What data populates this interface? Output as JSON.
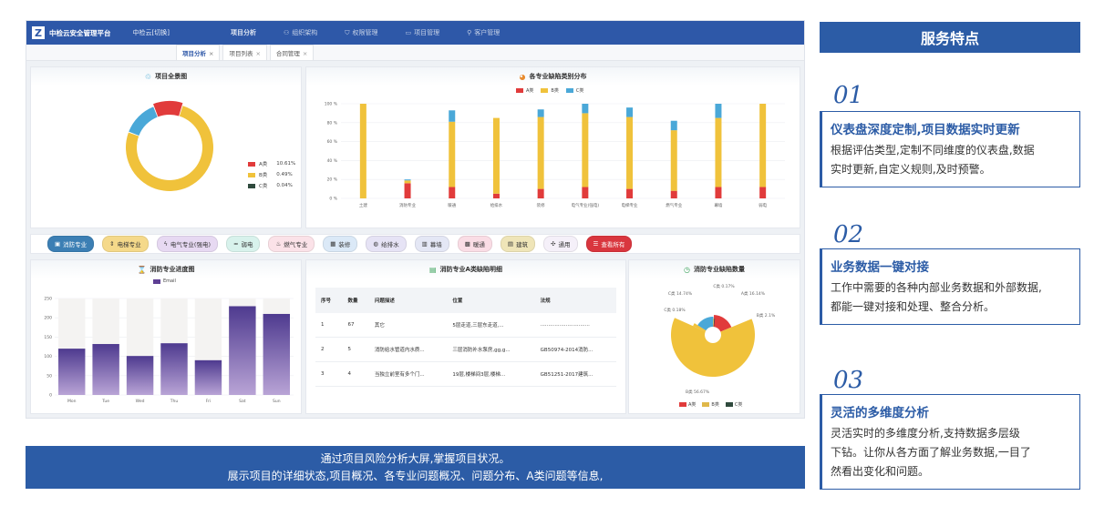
{
  "app": {
    "title": "中检云安全管理平台",
    "tenant": "中检云[切换]",
    "nav": [
      {
        "label": "项目分析",
        "icon": "chart-icon"
      },
      {
        "label": "组织架构",
        "icon": "org-icon"
      },
      {
        "label": "权限管理",
        "icon": "shield-icon"
      },
      {
        "label": "项目管理",
        "icon": "folder-icon"
      },
      {
        "label": "客户管理",
        "icon": "user-icon"
      }
    ],
    "tabs": [
      {
        "label": "项目分析",
        "close": "×"
      },
      {
        "label": "项目列表",
        "close": "×"
      },
      {
        "label": "合同管理",
        "close": "×"
      }
    ]
  },
  "overview": {
    "title": "项目全景图",
    "legend": [
      {
        "label": "A类",
        "value": "10.61%",
        "color": "#e13b3b"
      },
      {
        "label": "B类",
        "value": "0.49%",
        "color": "#f0c23b"
      },
      {
        "label": "C类",
        "value": "0.04%",
        "color": "#2f4a3d"
      }
    ]
  },
  "categories": [
    {
      "label": "消防专业",
      "icon": "fire-extinguisher-icon",
      "bg": "#3c7fb4",
      "color": "#ffffff"
    },
    {
      "label": "电梯专业",
      "icon": "elevator-icon",
      "bg": "#f5d98a",
      "color": "#333333"
    },
    {
      "label": "电气专业(强电)",
      "icon": "lightning-icon",
      "bg": "#e7d9f2",
      "color": "#333333"
    },
    {
      "label": "弱电",
      "icon": "wifi-icon",
      "bg": "#d8f2ec",
      "color": "#333333"
    },
    {
      "label": "燃气专业",
      "icon": "flame-icon",
      "bg": "#fbe2e8",
      "color": "#333333"
    },
    {
      "label": "装修",
      "icon": "paint-roller-icon",
      "bg": "#dbe9f7",
      "color": "#333333"
    },
    {
      "label": "给排水",
      "icon": "pipe-icon",
      "bg": "#e6e3f5",
      "color": "#333333"
    },
    {
      "label": "幕墙",
      "icon": "curtain-wall-icon",
      "bg": "#e4e7f5",
      "color": "#333333"
    },
    {
      "label": "暖通",
      "icon": "hvac-icon",
      "bg": "#fadde5",
      "color": "#333333"
    },
    {
      "label": "建筑",
      "icon": "building-icon",
      "bg": "#efe5b8",
      "color": "#333333"
    },
    {
      "label": "通用",
      "icon": "general-icon",
      "bg": "#f5f0f9",
      "color": "#333333"
    },
    {
      "label": "查看所有",
      "icon": "list-icon",
      "bg": "#d9363e",
      "color": "#ffffff"
    }
  ],
  "progress": {
    "title": "消防专业进度图"
  },
  "detail": {
    "title": "消防专业A类缺陷明细",
    "headers": [
      "序号",
      "数量",
      "问题描述",
      "位置",
      "法规"
    ],
    "rows": [
      [
        "1",
        "67",
        "其它",
        "5层走道,三层东走道,...",
        "..............................."
      ],
      [
        "2",
        "5",
        "消防给水管道内水质...",
        "三层消防补水泵房,gg,g...",
        "GB50974-2014消防..."
      ],
      [
        "3",
        "4",
        "当独立前室有多个门...",
        "19层,楼梯间3层,楼梯...",
        "GB51251-2017建筑..."
      ]
    ]
  },
  "defect_count": {
    "title": "消防专业缺陷数量",
    "labels": [
      {
        "text": "C类 14.74%",
        "color": "#4aa8d8"
      },
      {
        "text": "C类 0.17%",
        "color": "#f0c23b"
      },
      {
        "text": "A类 16.14%",
        "color": "#e13b3b"
      },
      {
        "text": "C类 0.18%",
        "color": "#444444"
      },
      {
        "text": "B类 2.1%",
        "color": "#f0c23b"
      },
      {
        "text": "B类 56.67%",
        "color": "#f0c23b"
      }
    ],
    "legend": [
      {
        "label": "A类",
        "color": "#e13b3b"
      },
      {
        "label": "B类",
        "color": "#e0b84a"
      },
      {
        "label": "C类",
        "color": "#2f4a3d"
      }
    ]
  },
  "banner": {
    "line1": "通过项目风险分析大屏,掌握项目状况。",
    "line2": "展示项目的详细状态,项目概况、各专业问题概况、问题分布、A类问题等信息,"
  },
  "features": {
    "title": "服务特点",
    "items": [
      {
        "num": "01",
        "heading": "仪表盘深度定制,项目数据实时更新",
        "lines": [
          "根据评估类型,定制不同维度的仪表盘,数据",
          "实时更新,自定义规则,及时预警。"
        ]
      },
      {
        "num": "02",
        "heading": "业务数据一键对接",
        "lines": [
          "工作中需要的各种内部业务数据和外部数据,",
          "都能一键对接和处理、整合分析。"
        ]
      },
      {
        "num": "03",
        "heading": "灵活的多维度分析",
        "lines": [
          "灵活实时的多维度分析,支持数据多层级",
          "下钻。让你从各方面了解业务数据,一目了",
          "然看出变化和问题。"
        ]
      }
    ]
  },
  "chart_data": [
    {
      "type": "pie",
      "title": "项目全景图",
      "slices": [
        {
          "name": "A类",
          "value": 10.61,
          "color": "#e13b3b"
        },
        {
          "name": "B类",
          "value": 76.0,
          "color": "#f0c23b"
        },
        {
          "name": "C类",
          "value": 13.39,
          "color": "#4aa8d8"
        }
      ]
    },
    {
      "type": "bar",
      "title": "各专业缺陷类别分布",
      "categories": [
        "土建",
        "消防专业",
        "暖通",
        "给排水",
        "装修",
        "电气专业(强电)",
        "电梯专业",
        "燃气专业",
        "幕墙",
        "弱电"
      ],
      "series": [
        {
          "name": "A类",
          "color": "#e13b3b",
          "values": [
            0,
            16,
            12,
            5,
            10,
            12,
            10,
            8,
            12,
            12
          ]
        },
        {
          "name": "B类",
          "color": "#f0c23b",
          "values": [
            100,
            3,
            69,
            80,
            76,
            78,
            76,
            64,
            73,
            88
          ]
        },
        {
          "name": "C类",
          "color": "#4aa8d8",
          "values": [
            0,
            1,
            12,
            0,
            8,
            10,
            10,
            10,
            15,
            0
          ]
        }
      ],
      "yticks": [
        "100 %",
        "80 %",
        "60 %",
        "40 %",
        "20 %",
        "0 %"
      ],
      "ylim": [
        0,
        100
      ]
    },
    {
      "type": "bar",
      "title": "消防专业进度图",
      "categories": [
        "Mon",
        "Tue",
        "Wed",
        "Thu",
        "Fri",
        "Sat",
        "Sun"
      ],
      "series": [
        {
          "name": "Email",
          "values": [
            120,
            132,
            101,
            134,
            90,
            230,
            210
          ]
        }
      ],
      "background_max": 250,
      "yticks": [
        "250",
        "200",
        "150",
        "100",
        "50",
        "0"
      ],
      "ylim": [
        0,
        250
      ]
    },
    {
      "type": "pie",
      "title": "消防专业缺陷数量",
      "slices": [
        {
          "name": "A类",
          "value": 16.14,
          "color": "#e13b3b"
        },
        {
          "name": "B类",
          "value": 56.67,
          "color": "#f0c23b"
        },
        {
          "name": "B类",
          "value": 2.1,
          "color": "#f0c23b"
        },
        {
          "name": "C类",
          "value": 14.74,
          "color": "#4aa8d8"
        },
        {
          "name": "C类",
          "value": 0.17,
          "color": "#f0c23b"
        },
        {
          "name": "C类",
          "value": 0.18,
          "color": "#444444"
        }
      ]
    }
  ]
}
